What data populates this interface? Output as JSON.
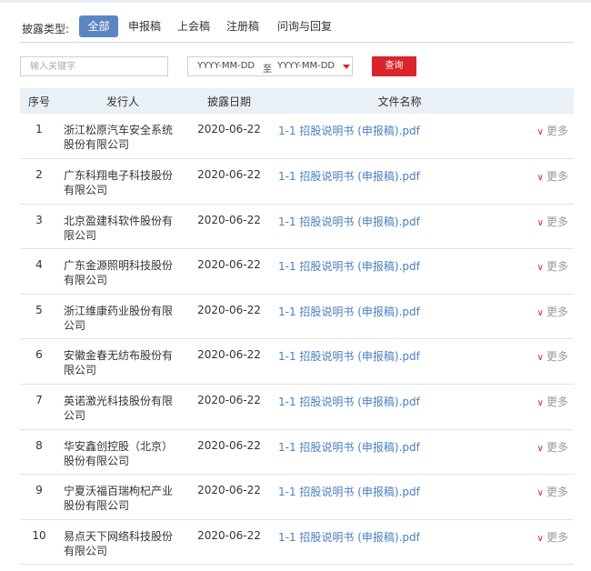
{
  "filters": {
    "label": "披露类型:",
    "tabs": [
      "全部",
      "申报稿",
      "上会稿",
      "注册稿",
      "问询与回复"
    ]
  },
  "search": {
    "keyword_placeholder": "输入关键字",
    "date_start_placeholder": "YYYY-MM-DD",
    "date_separator": "至",
    "date_end_placeholder": "YYYY-MM-DD",
    "query_label": "查询"
  },
  "table": {
    "headers": [
      "序号",
      "发行人",
      "披露日期",
      "文件名称",
      ""
    ],
    "more_label": "更多",
    "rows": [
      {
        "num": "1",
        "issuer": "浙江松原汽车安全系统股份有限公司",
        "date": "2020-06-22",
        "file": "1-1 招股说明书 (申报稿).pdf"
      },
      {
        "num": "2",
        "issuer": "广东科翔电子科技股份有限公司",
        "date": "2020-06-22",
        "file": "1-1 招股说明书 (申报稿).pdf"
      },
      {
        "num": "3",
        "issuer": "北京盈建科软件股份有限公司",
        "date": "2020-06-22",
        "file": "1-1 招股说明书 (申报稿).pdf"
      },
      {
        "num": "4",
        "issuer": "广东金源照明科技股份有限公司",
        "date": "2020-06-22",
        "file": "1-1 招股说明书 (申报稿).pdf"
      },
      {
        "num": "5",
        "issuer": "浙江维康药业股份有限公司",
        "date": "2020-06-22",
        "file": "1-1 招股说明书 (申报稿).pdf"
      },
      {
        "num": "6",
        "issuer": "安徽金春无纺布股份有限公司",
        "date": "2020-06-22",
        "file": "1-1 招股说明书 (申报稿).pdf"
      },
      {
        "num": "7",
        "issuer": "英诺激光科技股份有限公司",
        "date": "2020-06-22",
        "file": "1-1 招股说明书 (申报稿).pdf"
      },
      {
        "num": "8",
        "issuer": "华安鑫创控股（北京）股份有限公司",
        "date": "2020-06-22",
        "file": "1-1 招股说明书 (申报稿).pdf"
      },
      {
        "num": "9",
        "issuer": "宁夏沃福百瑞枸杞产业股份有限公司",
        "date": "2020-06-22",
        "file": "1-1 招股说明书 (申报稿).pdf"
      },
      {
        "num": "10",
        "issuer": "易点天下网络科技股份有限公司",
        "date": "2020-06-22",
        "file": "1-1 招股说明书 (申报稿).pdf"
      }
    ]
  },
  "colors": {
    "active_tab": "#5b86c2",
    "query_button": "#d9242b",
    "link": "#4a7fbf",
    "header_bg": "#e9f0f6"
  }
}
